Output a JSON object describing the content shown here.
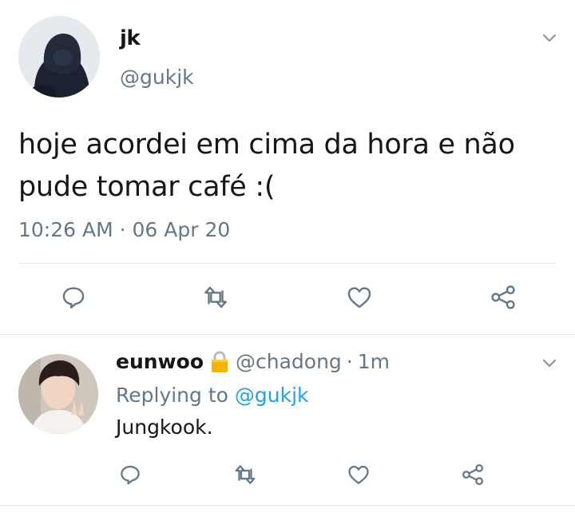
{
  "main_tweet": {
    "name": "jk",
    "handle": "@gukjk",
    "text_line1": "hoje acordei em cima da hora e não",
    "text_line2": "pude tomar café :(",
    "timestamp": "10:26 AM · 06 Apr 20"
  },
  "reply_tweet": {
    "name": "eunwoo",
    "handle": "@chadong",
    "separator": "·",
    "time": "1m",
    "replying_prefix": "Replying to",
    "replying_to": "@gukjk",
    "text": "Jungkook."
  },
  "icons": {
    "reply": "reply-icon",
    "retweet": "retweet-icon",
    "like": "heart-icon",
    "share": "share-icon",
    "menu": "chevron-down-icon",
    "lock": "lock-icon"
  },
  "colors": {
    "text": "#14171a",
    "secondary": "#657786",
    "link": "#1da1f2",
    "divider": "#e1e8ed",
    "lock": "#f5b400"
  }
}
